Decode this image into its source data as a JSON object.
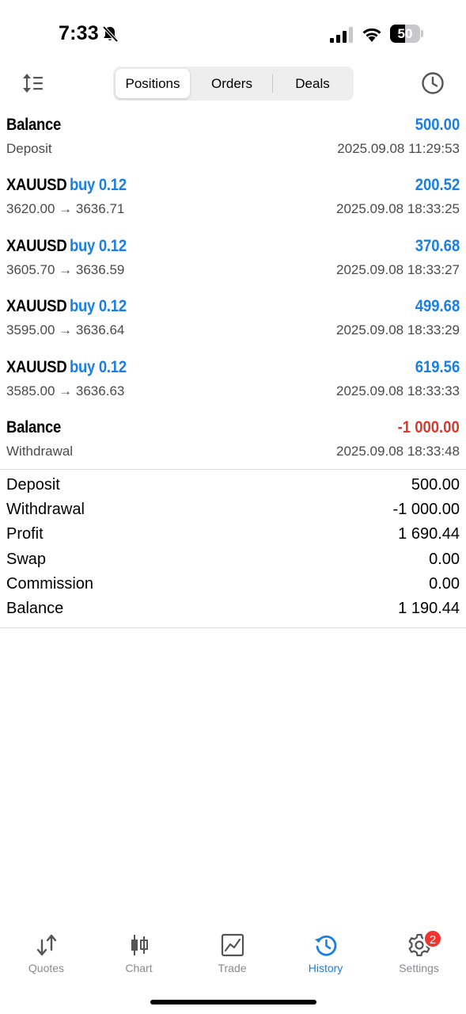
{
  "status_bar": {
    "time": "7:33",
    "battery": "50",
    "battery_level": 0.5
  },
  "toolbar": {
    "tabs": [
      {
        "label": "Positions",
        "active": true
      },
      {
        "label": "Orders",
        "active": false
      },
      {
        "label": "Deals",
        "active": false
      }
    ]
  },
  "records": [
    {
      "title": "Balance",
      "type": "",
      "amount": "500.00",
      "sub": "Deposit",
      "time": "2025.09.08 11:29:53",
      "negative": false
    },
    {
      "title": "XAUUSD",
      "type": "buy 0.12",
      "amount": "200.52",
      "sub": "3620.00 → 3636.71",
      "time": "2025.09.08 18:33:25",
      "negative": false
    },
    {
      "title": "XAUUSD",
      "type": "buy 0.12",
      "amount": "370.68",
      "sub": "3605.70 → 3636.59",
      "time": "2025.09.08 18:33:27",
      "negative": false
    },
    {
      "title": "XAUUSD",
      "type": "buy 0.12",
      "amount": "499.68",
      "sub": "3595.00 → 3636.64",
      "time": "2025.09.08 18:33:29",
      "negative": false
    },
    {
      "title": "XAUUSD",
      "type": "buy 0.12",
      "amount": "619.56",
      "sub": "3585.00 → 3636.63",
      "time": "2025.09.08 18:33:33",
      "negative": false
    },
    {
      "title": "Balance",
      "type": "",
      "amount": "-1 000.00",
      "sub": "Withdrawal",
      "time": "2025.09.08 18:33:48",
      "negative": true
    }
  ],
  "summary": [
    {
      "label": "Deposit",
      "value": "500.00"
    },
    {
      "label": "Withdrawal",
      "value": "-1 000.00"
    },
    {
      "label": "Profit",
      "value": "1 690.44"
    },
    {
      "label": "Swap",
      "value": "0.00"
    },
    {
      "label": "Commission",
      "value": "0.00"
    },
    {
      "label": "Balance",
      "value": "1 190.44"
    }
  ],
  "tabbar": {
    "items": [
      {
        "label": "Quotes",
        "icon": "quotes-icon",
        "active": false
      },
      {
        "label": "Chart",
        "icon": "chart-icon",
        "active": false
      },
      {
        "label": "Trade",
        "icon": "trade-icon",
        "active": false
      },
      {
        "label": "History",
        "icon": "history-icon",
        "active": true
      },
      {
        "label": "Settings",
        "icon": "settings-icon",
        "active": false
      }
    ],
    "settings_badge": "2"
  },
  "colors": {
    "accent": "#1a7fe0",
    "negative": "#e0352b",
    "badge": "#f0352e"
  }
}
